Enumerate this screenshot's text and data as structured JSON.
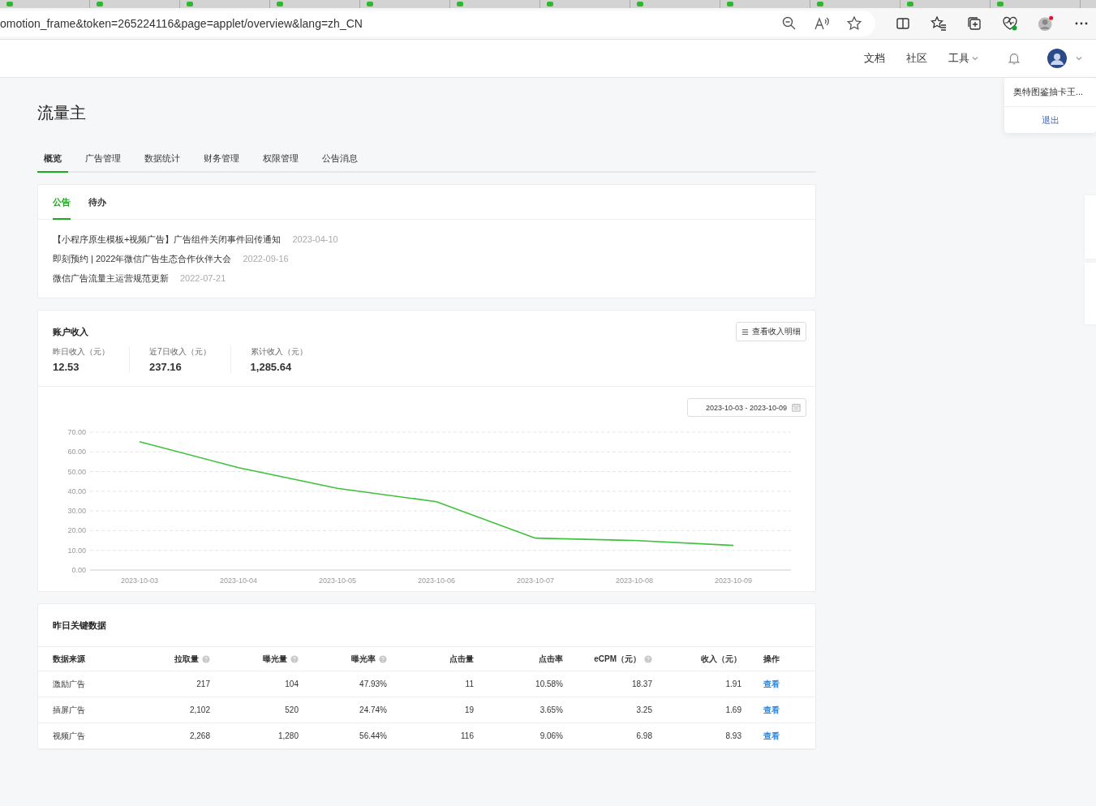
{
  "browser": {
    "url": "omotion_frame&token=265224116&page=applet/overview&lang=zh_CN"
  },
  "header": {
    "links": [
      {
        "label": "文档",
        "kind": "link"
      },
      {
        "label": "社区",
        "kind": "link"
      },
      {
        "label": "工具",
        "kind": "dropdown"
      }
    ]
  },
  "user_menu": {
    "name": "奥特图鉴抽卡王...",
    "logout": "退出"
  },
  "page_title": "流量主",
  "tabs": [
    {
      "label": "概览",
      "selected": true
    },
    {
      "label": "广告管理",
      "selected": false
    },
    {
      "label": "数据统计",
      "selected": false
    },
    {
      "label": "财务管理",
      "selected": false
    },
    {
      "label": "权限管理",
      "selected": false
    },
    {
      "label": "公告消息",
      "selected": false
    }
  ],
  "notice_card": {
    "tabs": [
      {
        "label": "公告",
        "selected": true
      },
      {
        "label": "待办",
        "selected": false
      }
    ],
    "items": [
      {
        "title": "【小程序原生模板+视频广告】广告组件关闭事件回传通知",
        "date": "2023-04-10"
      },
      {
        "title": "即刻预约 | 2022年微信广告生态合作伙伴大会",
        "date": "2022-09-16"
      },
      {
        "title": "微信广告流量主运营规范更新",
        "date": "2022-07-21"
      }
    ]
  },
  "income_card": {
    "title": "账户收入",
    "detail_button": "查看收入明细",
    "stats": [
      {
        "label": "昨日收入（元）",
        "value": "12.53"
      },
      {
        "label": "近7日收入（元）",
        "value": "237.16"
      },
      {
        "label": "累计收入（元）",
        "value": "1,285.64"
      }
    ],
    "date_range": "2023-10-03 - 2023-10-09",
    "chart_data": {
      "type": "line",
      "categories": [
        "2023-10-03",
        "2023-10-04",
        "2023-10-05",
        "2023-10-06",
        "2023-10-07",
        "2023-10-08",
        "2023-10-09"
      ],
      "series": [
        {
          "color": "#3cc13b",
          "values": [
            65.2,
            52,
            41.5,
            34.7,
            16.2,
            15,
            12.5
          ]
        }
      ],
      "grid": true,
      "ylim": [
        0,
        70
      ],
      "yticks": [
        {
          "value": 0,
          "label": "0.00"
        },
        {
          "value": 10,
          "label": "10.00"
        },
        {
          "value": 20,
          "label": "20.00"
        },
        {
          "value": 30,
          "label": "30.00"
        },
        {
          "value": 40,
          "label": "40.00"
        },
        {
          "value": 50,
          "label": "50.00"
        },
        {
          "value": 60,
          "label": "60.00"
        },
        {
          "value": 70,
          "label": "70.00"
        }
      ]
    }
  },
  "key_data": {
    "title": "昨日关键数据",
    "columns": [
      {
        "label": "数据来源",
        "help": false
      },
      {
        "label": "拉取量",
        "help": true
      },
      {
        "label": "曝光量",
        "help": true
      },
      {
        "label": "曝光率",
        "help": true
      },
      {
        "label": "点击量",
        "help": false
      },
      {
        "label": "点击率",
        "help": false
      },
      {
        "label": "eCPM（元）",
        "help": true
      },
      {
        "label": "收入（元）",
        "help": false
      },
      {
        "label": "操作",
        "help": false
      }
    ],
    "rows": [
      {
        "cells": [
          "激励广告",
          "217",
          "104",
          "47.93%",
          "11",
          "10.58%",
          "18.37",
          "1.91"
        ],
        "action": "查看"
      },
      {
        "cells": [
          "插屏广告",
          "2,102",
          "520",
          "24.74%",
          "19",
          "3.65%",
          "3.25",
          "1.69"
        ],
        "action": "查看"
      },
      {
        "cells": [
          "视频广告",
          "2,268",
          "1,280",
          "56.44%",
          "116",
          "9.06%",
          "6.98",
          "8.93"
        ],
        "action": "查看"
      }
    ]
  }
}
